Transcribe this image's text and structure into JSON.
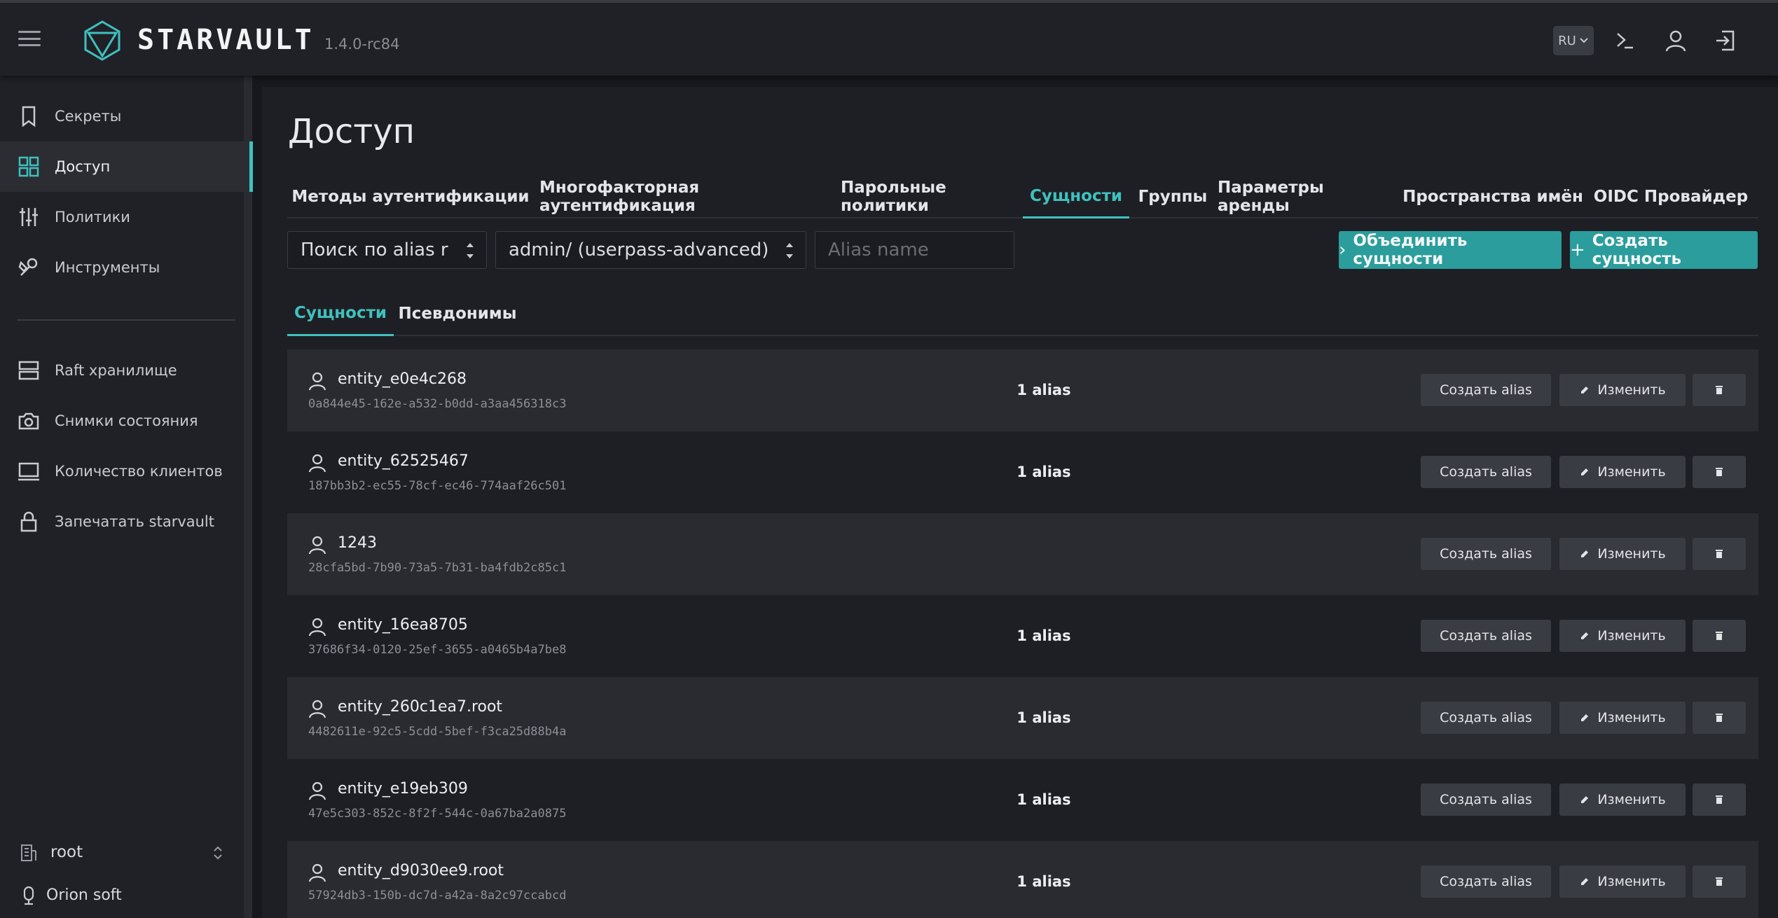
{
  "app": {
    "brand": "STARVAULT",
    "version": "1.4.0-rc84"
  },
  "header": {
    "lang": "RU",
    "icons": [
      "console-icon",
      "user-icon",
      "logout-icon"
    ]
  },
  "sidebar": {
    "items": [
      {
        "label": "Секреты",
        "icon": "bookmark-icon"
      },
      {
        "label": "Доступ",
        "icon": "grid-icon",
        "active": true
      },
      {
        "label": "Политики",
        "icon": "sliders-icon"
      },
      {
        "label": "Инструменты",
        "icon": "tools-icon"
      },
      {
        "label": "Raft хранилище",
        "icon": "server-icon"
      },
      {
        "label": "Снимки состояния",
        "icon": "camera-icon"
      },
      {
        "label": "Количество клиентов",
        "icon": "monitor-icon"
      },
      {
        "label": "Запечатать starvault",
        "icon": "lock-icon"
      }
    ],
    "namespace": "root",
    "org": "Orion soft"
  },
  "page": {
    "title": "Доступ"
  },
  "tabs": [
    "Методы аутентификации",
    "Многофакторная аутентификация",
    "Парольные политики",
    "Сущности",
    "Группы",
    "Параметры аренды",
    "Пространства имён",
    "OIDC Провайдер"
  ],
  "active_tab": "Сущности",
  "filters": {
    "search_mode": "Поиск по alias r",
    "mount": "admin/ (userpass-advanced)",
    "alias_placeholder": "Alias name"
  },
  "actions": {
    "merge": "Объединить сущности",
    "create": "Создать сущность"
  },
  "subtabs": [
    "Сущности",
    "Псевдонимы"
  ],
  "row_buttons": {
    "create_alias": "Создать alias",
    "edit": "Изменить"
  },
  "colors": {
    "accent": "#3fc1be",
    "primary_button": "#2a9d9c"
  },
  "entities": [
    {
      "name": "entity_e0e4c268",
      "id": "0a844e45-162e-a532-b0dd-a3aa456318c3",
      "aliases": "1 alias"
    },
    {
      "name": "entity_62525467",
      "id": "187bb3b2-ec55-78cf-ec46-774aaf26c501",
      "aliases": "1 alias"
    },
    {
      "name": "1243",
      "id": "28cfa5bd-7b90-73a5-7b31-ba4fdb2c85c1",
      "aliases": ""
    },
    {
      "name": "entity_16ea8705",
      "id": "37686f34-0120-25ef-3655-a0465b4a7be8",
      "aliases": "1 alias"
    },
    {
      "name": "entity_260c1ea7.root",
      "id": "4482611e-92c5-5cdd-5bef-f3ca25d88b4a",
      "aliases": "1 alias"
    },
    {
      "name": "entity_e19eb309",
      "id": "47e5c303-852c-8f2f-544c-0a67ba2a0875",
      "aliases": "1 alias"
    },
    {
      "name": "entity_d9030ee9.root",
      "id": "57924db3-150b-dc7d-a42a-8a2c97ccabcd",
      "aliases": "1 alias"
    }
  ]
}
